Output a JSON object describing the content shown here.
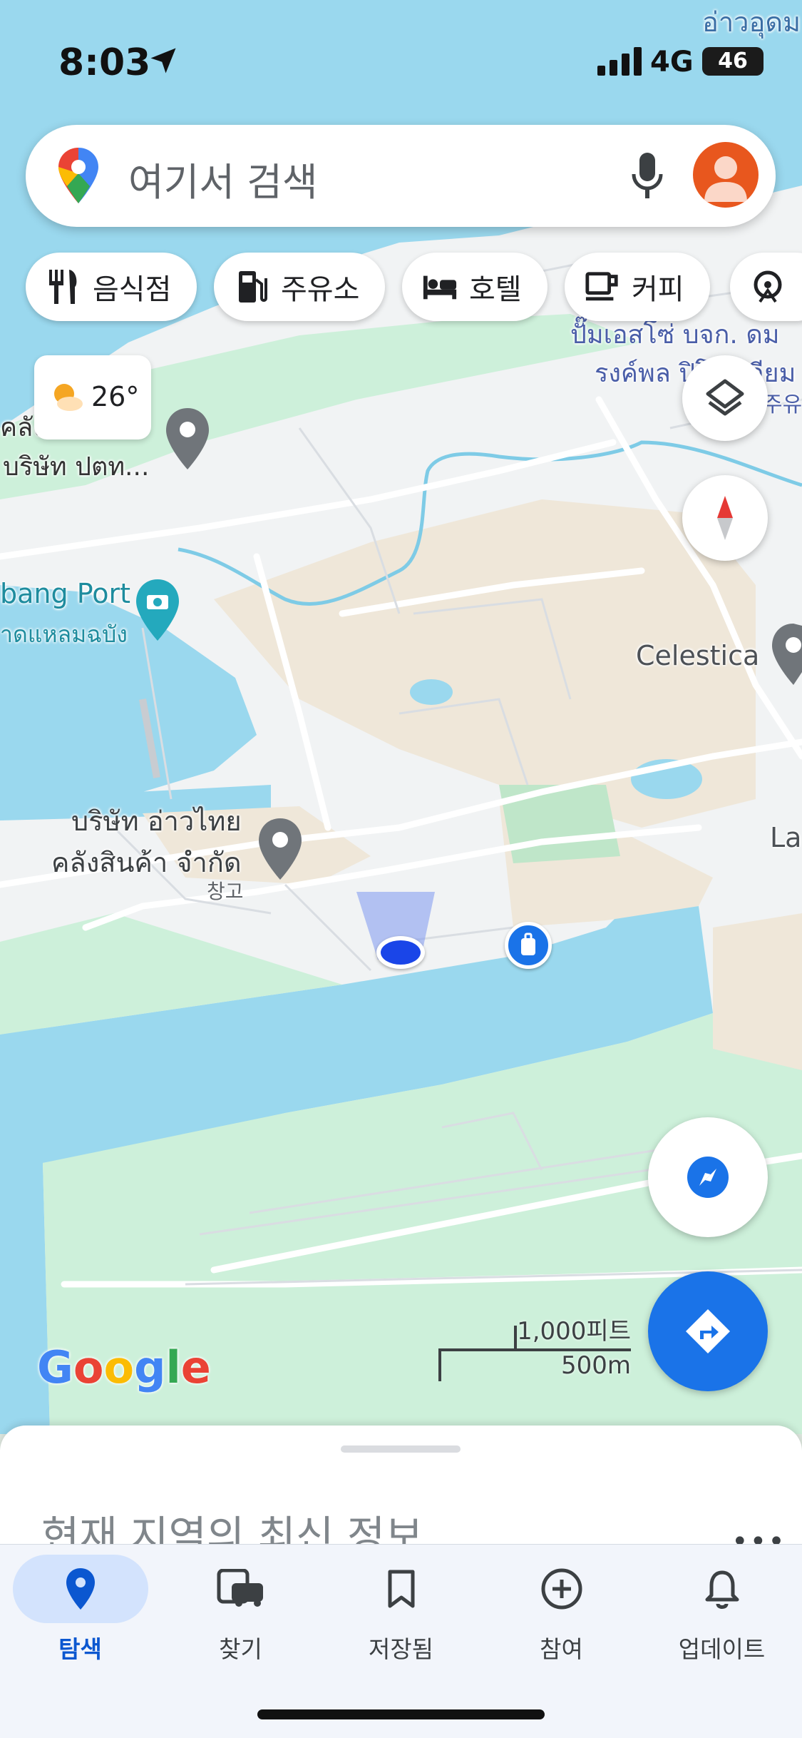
{
  "status_bar": {
    "time": "8:03",
    "network": "4G",
    "battery": "46"
  },
  "search": {
    "placeholder": "여기서 검색"
  },
  "chips": [
    {
      "label": "음식점",
      "icon": "restaurant-icon"
    },
    {
      "label": "주유소",
      "icon": "gas-station-icon"
    },
    {
      "label": "호텔",
      "icon": "hotel-icon"
    },
    {
      "label": "커피",
      "icon": "coffee-icon"
    },
    {
      "label": "",
      "icon": "attractions-icon"
    }
  ],
  "weather": {
    "temp": "26°"
  },
  "map": {
    "labels": {
      "top_right": "อ่าวอุดม",
      "company1": "ปั๊มเอสโซ่ บจก. ดม",
      "company1_b": "รงค์พล ปิโตรเลียม",
      "company1_c": "주유",
      "ptt_a": "คลังก๊าซ",
      "ptt_b": "บริษัท ปตท...",
      "port_a": "bang Port",
      "port_b": "าดแหลมฉบัง",
      "celestica": "Celestica",
      "warehouse_a": "บริษัท อ่าวไทย",
      "warehouse_b": "คลังสินค้า จำกัด",
      "warehouse_c": "창고",
      "la": "La"
    },
    "scale": {
      "imperial": "1,000피트",
      "metric": "500m"
    },
    "google_logo": [
      "G",
      "o",
      "o",
      "g",
      "l",
      "e"
    ]
  },
  "sheet": {
    "title": "현재 지역의 최신 정보...",
    "more": "•••"
  },
  "nav": [
    {
      "label": "탐색",
      "icon": "explore-pin-icon",
      "active": true
    },
    {
      "label": "찾기",
      "icon": "transit-icon",
      "active": false
    },
    {
      "label": "저장됨",
      "icon": "bookmark-icon",
      "active": false
    },
    {
      "label": "참여",
      "icon": "contribute-plus-icon",
      "active": false
    },
    {
      "label": "업데이트",
      "icon": "bell-icon",
      "active": false
    }
  ],
  "colors": {
    "accent": "#1a73e8",
    "water": "#9ad8ee",
    "park": "#cdf0da",
    "land": "#f1f3f4"
  }
}
